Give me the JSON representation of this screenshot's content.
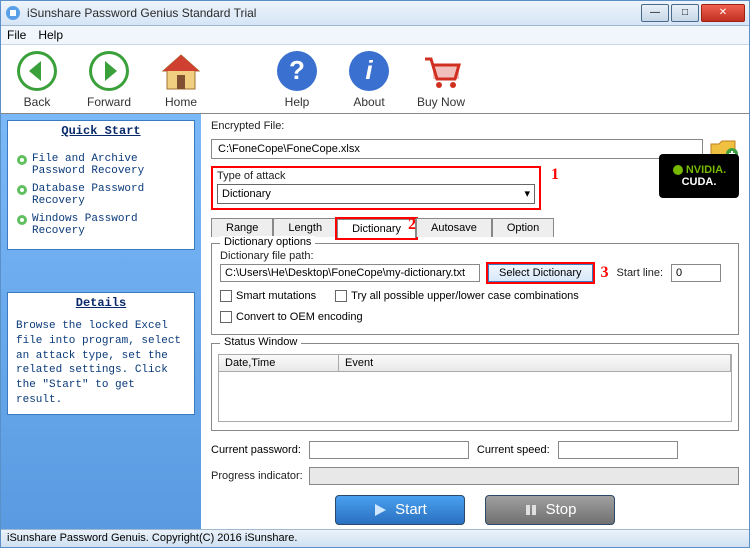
{
  "window": {
    "title": "iSunshare Password Genius Standard Trial"
  },
  "menu": {
    "file": "File",
    "help": "Help"
  },
  "toolbar": {
    "back": "Back",
    "forward": "Forward",
    "home": "Home",
    "help": "Help",
    "about": "About",
    "buynow": "Buy Now"
  },
  "sidebar": {
    "quickstart_title": "Quick Start",
    "links": [
      "File and Archive Password Recovery",
      "Database Password Recovery",
      "Windows Password Recovery"
    ],
    "details_title": "Details",
    "details_text": "Browse the locked Excel file into program, select an attack type, set the related settings. Click the \"Start\" to get result."
  },
  "main": {
    "encrypted_label": "Encrypted File:",
    "encrypted_value": "C:\\FoneCope\\FoneCope.xlsx",
    "attack_label": "Type of attack",
    "attack_value": "Dictionary",
    "mark1": "1",
    "mark2": "2",
    "mark3": "3",
    "tabs": {
      "range": "Range",
      "length": "Length",
      "dictionary": "Dictionary",
      "autosave": "Autosave",
      "option": "Option"
    },
    "dict": {
      "group_title": "Dictionary options",
      "path_label": "Dictionary file path:",
      "path_value": "C:\\Users\\He\\Desktop\\FoneCope\\my-dictionary.txt",
      "select_btn": "Select Dictionary",
      "startline_label": "Start line:",
      "startline_value": "0",
      "smart": "Smart mutations",
      "tryall": "Try all possible upper/lower case combinations",
      "oem": "Convert to OEM encoding"
    },
    "status": {
      "title": "Status Window",
      "col1": "Date,Time",
      "col2": "Event"
    },
    "current_password_label": "Current password:",
    "current_speed_label": "Current speed:",
    "progress_label": "Progress indicator:",
    "start_btn": "Start",
    "stop_btn": "Stop",
    "cuda_top": "NVIDIA.",
    "cuda_bottom": "CUDA."
  },
  "footer": {
    "text": "iSunshare Password Genuis. Copyright(C) 2016 iSunshare."
  }
}
